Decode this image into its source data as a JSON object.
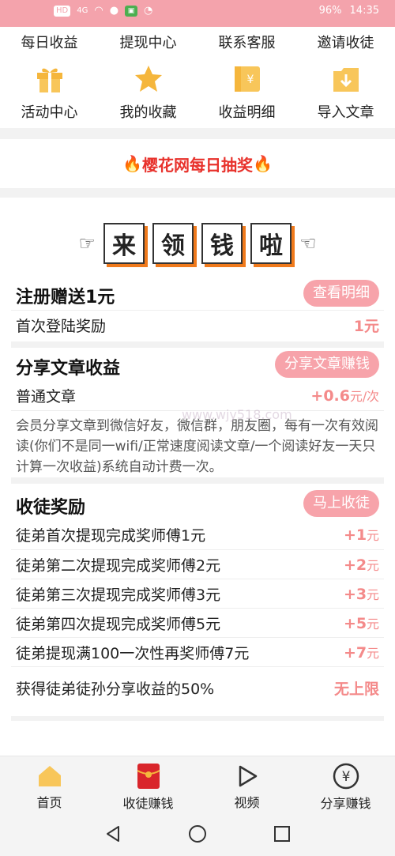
{
  "status": {
    "left_icons": [
      "HD",
      "4G",
      "signal",
      "wifi",
      "person",
      "app",
      "alarm"
    ],
    "battery": "96%",
    "time": "14:35"
  },
  "top_links": [
    "每日收益",
    "提现中心",
    "联系客服",
    "邀请收徒"
  ],
  "icon_links": [
    {
      "label": "活动中心",
      "icon": "gift-icon"
    },
    {
      "label": "我的收藏",
      "icon": "star-icon"
    },
    {
      "label": "收益明细",
      "icon": "ticket-icon"
    },
    {
      "label": "导入文章",
      "icon": "import-icon"
    }
  ],
  "lottery": {
    "text": "樱花网每日抽奖",
    "fire_left": "🔥",
    "fire_right": "🔥"
  },
  "banner": {
    "hand_left": "☜",
    "hand_right": "☞",
    "chars": [
      "来",
      "领",
      "钱",
      "啦"
    ]
  },
  "register": {
    "title": "注册赠送1元",
    "button": "查看明细",
    "rows": [
      {
        "label": "首次登陆奖励",
        "value": "1元"
      }
    ]
  },
  "share": {
    "title": "分享文章收益",
    "button": "分享文章赚钱",
    "row_label": "普通文章",
    "row_value": "+0.6",
    "row_unit": "元/次",
    "desc": "会员分享文章到微信好友，微信群，朋友圈，每有一次有效阅读(你们不是同一wifi/正常速度阅读文章/一个阅读好友一天只计算一次收益)系统自动计费一次。"
  },
  "apprentice": {
    "title": "收徒奖励",
    "button": "马上收徒",
    "rows": [
      {
        "label": "徒弟首次提现完成奖师傅1元",
        "value": "+1",
        "unit": "元"
      },
      {
        "label": "徒弟第二次提现完成奖师傅2元",
        "value": "+2",
        "unit": "元"
      },
      {
        "label": "徒弟第三次提现完成奖师傅3元",
        "value": "+3",
        "unit": "元"
      },
      {
        "label": "徒弟第四次提现完成奖师傅5元",
        "value": "+5",
        "unit": "元"
      },
      {
        "label": "徒弟提现满100一次性再奖师傅7元",
        "value": "+7",
        "unit": "元"
      }
    ],
    "last_label": "获得徒弟徒孙分享收益的50%",
    "last_value": "无上限"
  },
  "watermark": "www.wjy518.com",
  "tabs": [
    {
      "label": "首页",
      "icon": "home-icon"
    },
    {
      "label": "收徒赚钱",
      "icon": "red-envelope-icon"
    },
    {
      "label": "视频",
      "icon": "play-icon"
    },
    {
      "label": "分享赚钱",
      "icon": "yen-icon"
    }
  ],
  "colors": {
    "accent": "#f4a3ac",
    "value": "#f48a8a",
    "red": "#e8322c",
    "orange": "#f07a1c"
  }
}
